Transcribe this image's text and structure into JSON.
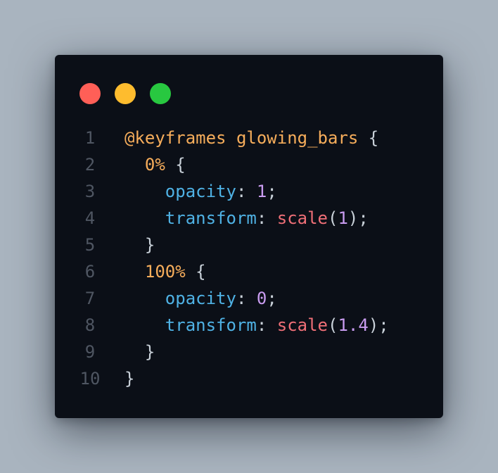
{
  "window": {
    "controls": [
      {
        "name": "close",
        "color": "#ff5f57"
      },
      {
        "name": "minimize",
        "color": "#febc2e"
      },
      {
        "name": "maximize",
        "color": "#28c840"
      }
    ]
  },
  "code": {
    "language": "css",
    "colors": {
      "background": "#0b0f17",
      "keyword": "#f6ad5b",
      "property": "#4fb2e5",
      "number": "#c99cf0",
      "function": "#ef6f77",
      "punctuation": "#c9d1d9",
      "line_number": "#4f5662"
    },
    "lines": [
      {
        "number": "1",
        "indent": "",
        "tokens": [
          {
            "text": "@keyframes",
            "type": "keyword"
          },
          {
            "text": " ",
            "type": "punct"
          },
          {
            "text": "glowing_bars",
            "type": "name"
          },
          {
            "text": " {",
            "type": "punct"
          }
        ]
      },
      {
        "number": "2",
        "indent": "  ",
        "tokens": [
          {
            "text": "0%",
            "type": "selector"
          },
          {
            "text": " {",
            "type": "punct"
          }
        ]
      },
      {
        "number": "3",
        "indent": "    ",
        "tokens": [
          {
            "text": "opacity",
            "type": "prop"
          },
          {
            "text": ": ",
            "type": "punct"
          },
          {
            "text": "1",
            "type": "num"
          },
          {
            "text": ";",
            "type": "punct"
          }
        ]
      },
      {
        "number": "4",
        "indent": "    ",
        "tokens": [
          {
            "text": "transform",
            "type": "prop"
          },
          {
            "text": ": ",
            "type": "punct"
          },
          {
            "text": "scale",
            "type": "func"
          },
          {
            "text": "(",
            "type": "punct"
          },
          {
            "text": "1",
            "type": "num"
          },
          {
            "text": ");",
            "type": "punct"
          }
        ]
      },
      {
        "number": "5",
        "indent": "  ",
        "tokens": [
          {
            "text": "}",
            "type": "punct"
          }
        ]
      },
      {
        "number": "6",
        "indent": "  ",
        "tokens": [
          {
            "text": "100%",
            "type": "selector"
          },
          {
            "text": " {",
            "type": "punct"
          }
        ]
      },
      {
        "number": "7",
        "indent": "    ",
        "tokens": [
          {
            "text": "opacity",
            "type": "prop"
          },
          {
            "text": ": ",
            "type": "punct"
          },
          {
            "text": "0",
            "type": "num"
          },
          {
            "text": ";",
            "type": "punct"
          }
        ]
      },
      {
        "number": "8",
        "indent": "    ",
        "tokens": [
          {
            "text": "transform",
            "type": "prop"
          },
          {
            "text": ": ",
            "type": "punct"
          },
          {
            "text": "scale",
            "type": "func"
          },
          {
            "text": "(",
            "type": "punct"
          },
          {
            "text": "1.4",
            "type": "num"
          },
          {
            "text": ");",
            "type": "punct"
          }
        ]
      },
      {
        "number": "9",
        "indent": "  ",
        "tokens": [
          {
            "text": "}",
            "type": "punct"
          }
        ]
      },
      {
        "number": "10",
        "indent": "",
        "tokens": [
          {
            "text": "}",
            "type": "punct"
          }
        ]
      }
    ]
  }
}
